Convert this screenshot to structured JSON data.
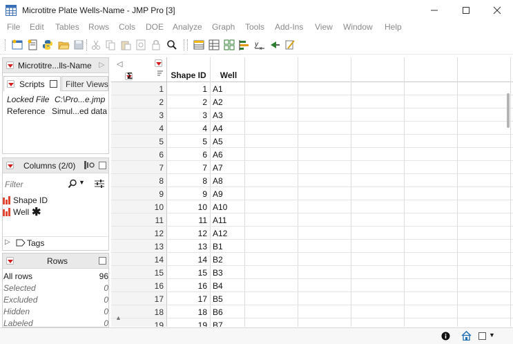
{
  "window": {
    "title": "Microtitre Plate Wells-Name - JMP Pro [3]"
  },
  "menu": [
    "File",
    "Edit",
    "Tables",
    "Rows",
    "Cols",
    "DOE",
    "Analyze",
    "Graph",
    "Tools",
    "Add-Ins",
    "View",
    "Window",
    "Help"
  ],
  "table_panel": {
    "name": "Microtitre...lls-Name",
    "tabs": {
      "scripts": "Scripts",
      "filter_views": "Filter Views"
    },
    "scripts": [
      {
        "name": "Locked File",
        "value": "C:\\Pro...e.jmp"
      },
      {
        "name": "Reference",
        "value": "Simul...ed data"
      }
    ]
  },
  "columns_panel": {
    "title": "Columns (2/0)",
    "filter_placeholder": "Filter",
    "columns": [
      {
        "name": "Shape ID",
        "marker": ""
      },
      {
        "name": "Well",
        "marker": "✱"
      }
    ],
    "tags_label": "Tags"
  },
  "rows_panel": {
    "title": "Rows",
    "stats": [
      {
        "label": "All rows",
        "value": "96"
      },
      {
        "label": "Selected",
        "value": "0"
      },
      {
        "label": "Excluded",
        "value": "0"
      },
      {
        "label": "Hidden",
        "value": "0"
      },
      {
        "label": "Labeled",
        "value": "0"
      }
    ]
  },
  "grid": {
    "sigma": "Σ",
    "headers": [
      "Shape ID",
      "Well"
    ],
    "rows": [
      [
        "1",
        "1",
        "A1"
      ],
      [
        "2",
        "2",
        "A2"
      ],
      [
        "3",
        "3",
        "A3"
      ],
      [
        "4",
        "4",
        "A4"
      ],
      [
        "5",
        "5",
        "A5"
      ],
      [
        "6",
        "6",
        "A6"
      ],
      [
        "7",
        "7",
        "A7"
      ],
      [
        "8",
        "8",
        "A8"
      ],
      [
        "9",
        "9",
        "A9"
      ],
      [
        "10",
        "10",
        "A10"
      ],
      [
        "11",
        "11",
        "A11"
      ],
      [
        "12",
        "12",
        "A12"
      ],
      [
        "13",
        "13",
        "B1"
      ],
      [
        "14",
        "14",
        "B2"
      ],
      [
        "15",
        "15",
        "B3"
      ],
      [
        "16",
        "16",
        "B4"
      ],
      [
        "17",
        "17",
        "B5"
      ],
      [
        "18",
        "18",
        "B6"
      ],
      [
        "19",
        "19",
        "B7"
      ]
    ]
  },
  "colors": {
    "accent_red": "#d01c1c",
    "panel_header_bg": "#e9e9e9",
    "chart_icon": "#e0462f"
  }
}
